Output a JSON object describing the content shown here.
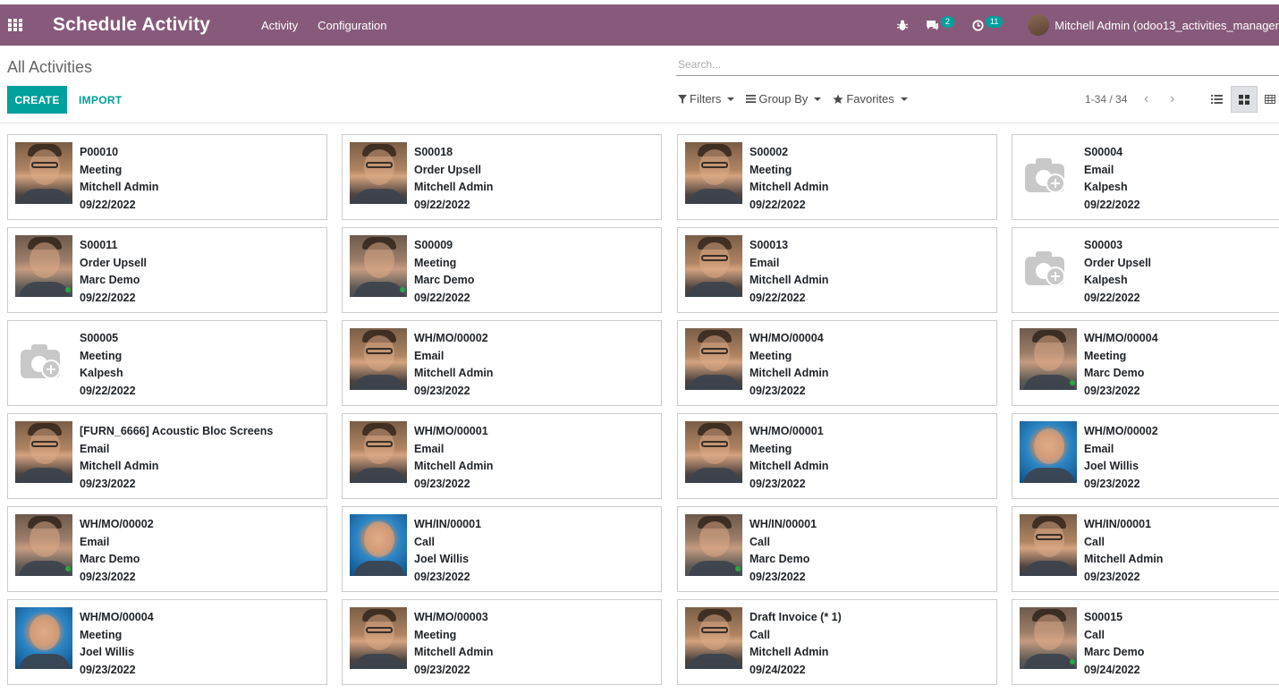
{
  "app": {
    "title": "Schedule Activity",
    "menu": [
      "Activity",
      "Configuration"
    ],
    "messages_count": "2",
    "activities_count": "11",
    "user": "Mitchell Admin (odoo13_activities_manager"
  },
  "control_panel": {
    "breadcrumb": "All Activities",
    "search_placeholder": "Search...",
    "create_label": "CREATE",
    "import_label": "IMPORT",
    "filters_label": "Filters",
    "groupby_label": "Group By",
    "favorites_label": "Favorites",
    "pager": "1-34 / 34"
  },
  "colors": {
    "brand": "#875a7b",
    "accent": "#00a09d"
  },
  "cards": [
    {
      "ref": "P00010",
      "type": "Meeting",
      "user": "Mitchell Admin",
      "date": "09/22/2022",
      "photo": "mitchell"
    },
    {
      "ref": "S00018",
      "type": "Order Upsell",
      "user": "Mitchell Admin",
      "date": "09/22/2022",
      "photo": "mitchell"
    },
    {
      "ref": "S00002",
      "type": "Meeting",
      "user": "Mitchell Admin",
      "date": "09/22/2022",
      "photo": "mitchell"
    },
    {
      "ref": "S00004",
      "type": "Email",
      "user": "Kalpesh",
      "date": "09/22/2022",
      "photo": "none"
    },
    {
      "ref": "S00011",
      "type": "Order Upsell",
      "user": "Marc Demo",
      "date": "09/22/2022",
      "photo": "marc"
    },
    {
      "ref": "S00009",
      "type": "Meeting",
      "user": "Marc Demo",
      "date": "09/22/2022",
      "photo": "marc"
    },
    {
      "ref": "S00013",
      "type": "Email",
      "user": "Mitchell Admin",
      "date": "09/22/2022",
      "photo": "mitchell"
    },
    {
      "ref": "S00003",
      "type": "Order Upsell",
      "user": "Kalpesh",
      "date": "09/22/2022",
      "photo": "none"
    },
    {
      "ref": "S00005",
      "type": "Meeting",
      "user": "Kalpesh",
      "date": "09/22/2022",
      "photo": "none"
    },
    {
      "ref": "WH/MO/00002",
      "type": "Email",
      "user": "Mitchell Admin",
      "date": "09/23/2022",
      "photo": "mitchell"
    },
    {
      "ref": "WH/MO/00004",
      "type": "Meeting",
      "user": "Mitchell Admin",
      "date": "09/23/2022",
      "photo": "mitchell"
    },
    {
      "ref": "WH/MO/00004",
      "type": "Meeting",
      "user": "Marc Demo",
      "date": "09/23/2022",
      "photo": "marc"
    },
    {
      "ref": "[FURN_6666] Acoustic Bloc Screens",
      "type": "Email",
      "user": "Mitchell Admin",
      "date": "09/23/2022",
      "photo": "mitchell"
    },
    {
      "ref": "WH/MO/00001",
      "type": "Email",
      "user": "Mitchell Admin",
      "date": "09/23/2022",
      "photo": "mitchell"
    },
    {
      "ref": "WH/MO/00001",
      "type": "Meeting",
      "user": "Mitchell Admin",
      "date": "09/23/2022",
      "photo": "mitchell"
    },
    {
      "ref": "WH/MO/00002",
      "type": "Email",
      "user": "Joel Willis",
      "date": "09/23/2022",
      "photo": "joel"
    },
    {
      "ref": "WH/MO/00002",
      "type": "Email",
      "user": "Marc Demo",
      "date": "09/23/2022",
      "photo": "marc"
    },
    {
      "ref": "WH/IN/00001",
      "type": "Call",
      "user": "Joel Willis",
      "date": "09/23/2022",
      "photo": "joel"
    },
    {
      "ref": "WH/IN/00001",
      "type": "Call",
      "user": "Marc Demo",
      "date": "09/23/2022",
      "photo": "marc"
    },
    {
      "ref": "WH/IN/00001",
      "type": "Call",
      "user": "Mitchell Admin",
      "date": "09/23/2022",
      "photo": "mitchell"
    },
    {
      "ref": "WH/MO/00004",
      "type": "Meeting",
      "user": "Joel Willis",
      "date": "09/23/2022",
      "photo": "joel"
    },
    {
      "ref": "WH/MO/00003",
      "type": "Meeting",
      "user": "Mitchell Admin",
      "date": "09/23/2022",
      "photo": "mitchell"
    },
    {
      "ref": "Draft Invoice (* 1)",
      "type": "Call",
      "user": "Mitchell Admin",
      "date": "09/24/2022",
      "photo": "mitchell"
    },
    {
      "ref": "S00015",
      "type": "Call",
      "user": "Marc Demo",
      "date": "09/24/2022",
      "photo": "marc"
    }
  ]
}
